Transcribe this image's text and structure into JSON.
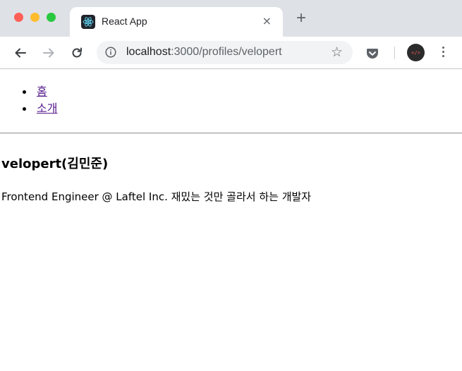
{
  "browser": {
    "tab": {
      "title": "React App",
      "close_label": "×"
    },
    "new_tab_label": "+",
    "address": {
      "host": "localhost",
      "rest": ":3000/profiles/velopert"
    },
    "avatar_text": "</>"
  },
  "page": {
    "nav": [
      {
        "label": "홈"
      },
      {
        "label": "소개"
      }
    ],
    "profile": {
      "name": "velopert(김민준)",
      "description": "Frontend Engineer @ Laftel Inc. 재밌는 것만 골라서 하는 개발자"
    }
  },
  "colors": {
    "link": "#551a8b",
    "tabbar": "#dee1e6",
    "omnibox": "#f1f3f4"
  }
}
